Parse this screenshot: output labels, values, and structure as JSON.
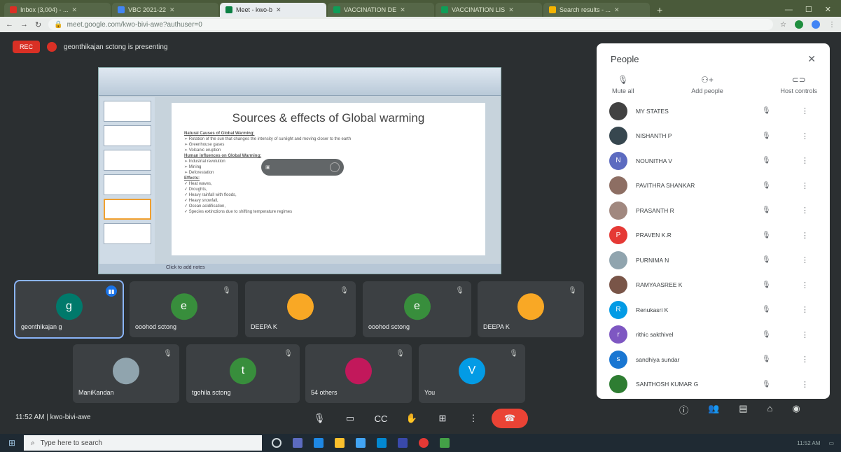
{
  "browser": {
    "tabs": [
      {
        "label": "Inbox (3,004) - ...",
        "color": "#d93025",
        "active": false
      },
      {
        "label": "VBC 2021-22",
        "color": "#4285f4",
        "active": false
      },
      {
        "label": "Meet - kwo-b",
        "color": "#0b8043",
        "active": true
      },
      {
        "label": "VACCINATION DE",
        "color": "#0f9d58",
        "active": false
      },
      {
        "label": "VACCINATION LIS",
        "color": "#0f9d58",
        "active": false
      },
      {
        "label": "Search results - ...",
        "color": "#f4b400",
        "active": false
      }
    ],
    "url": "meet.google.com/kwo-bivi-awe?authuser=0"
  },
  "meet": {
    "rec_label": "REC",
    "presenting_text": "geonthikajan sctong is presenting",
    "meeting_info": "11:52 AM  |  kwo-bivi-awe",
    "colors": {
      "accent": "#1a73e8",
      "hangup": "#ea4335",
      "panel_bg": "#ffffff",
      "stage_bg": "#2b2f31"
    }
  },
  "slide": {
    "title": "Sources & effects of Global warming",
    "lines": [
      {
        "text": "Natural Causes of Global Warming:",
        "heading": true
      },
      {
        "text": "➢  Rotation of the sun that changes the intensity of sunlight and moving closer to the earth",
        "heading": false
      },
      {
        "text": "➢  Greenhouse gases",
        "heading": false
      },
      {
        "text": "➢  Volcanic eruption",
        "heading": false
      },
      {
        "text": "Human influences on Global Warming:",
        "heading": true
      },
      {
        "text": "➢  Industrial revolution",
        "heading": false
      },
      {
        "text": "➢  Mining",
        "heading": false
      },
      {
        "text": "➢  Deforestation",
        "heading": false
      },
      {
        "text": "Effects:",
        "heading": true
      },
      {
        "text": "✓  Heat waves,",
        "heading": false
      },
      {
        "text": "✓  Droughts,",
        "heading": false
      },
      {
        "text": "✓  Heavy rainfall with floods,",
        "heading": false
      },
      {
        "text": "✓  Heavy snowfall,",
        "heading": false
      },
      {
        "text": "✓  Ocean acidification,",
        "heading": false
      },
      {
        "text": "✓  Species extinctions due to shifting temperature regimes",
        "heading": false
      }
    ],
    "status": "Click to add notes"
  },
  "tiles": [
    {
      "name": "geonthikajan g",
      "initial": "g",
      "color": "#00796b"
    },
    {
      "name": "ooohod sctong",
      "initial": "e",
      "color": "#388e3c"
    },
    {
      "name": "DEEPA K",
      "initial": "",
      "color": "#f9a825"
    },
    {
      "name": "ooohod sctong",
      "initial": "e",
      "color": "#388e3c"
    },
    {
      "name": "DEEPA K",
      "initial": "",
      "color": "#f9a825"
    },
    {
      "name": "ManiKandan",
      "initial": "",
      "color": "#90a4ae"
    },
    {
      "name": "tgohila sctong",
      "initial": "t",
      "color": "#388e3c"
    },
    {
      "name": "54 others",
      "initial": "",
      "color": "#c2185b"
    },
    {
      "name": "You",
      "initial": "V",
      "color": "#039be5"
    }
  ],
  "people": {
    "title": "People",
    "actions": {
      "mute_all": "Mute all",
      "add_people": "Add people",
      "host_controls": "Host controls"
    },
    "list": [
      {
        "name": "MY STATES",
        "color": "#424242",
        "initial": ""
      },
      {
        "name": "NISHANTH P",
        "color": "#37474f",
        "initial": ""
      },
      {
        "name": "NOUNITHA V",
        "color": "#5c6bc0",
        "initial": "N"
      },
      {
        "name": "PAVITHRA SHANKAR",
        "color": "#8d6e63",
        "initial": ""
      },
      {
        "name": "PRASANTH R",
        "color": "#a1887f",
        "initial": ""
      },
      {
        "name": "PRAVEN K.R",
        "color": "#e53935",
        "initial": "P"
      },
      {
        "name": "PURNIMA N",
        "color": "#90a4ae",
        "initial": ""
      },
      {
        "name": "RAMYAASREE K",
        "color": "#795548",
        "initial": ""
      },
      {
        "name": "Renukasri K",
        "color": "#039be5",
        "initial": "R"
      },
      {
        "name": "rithic sakthivel",
        "color": "#7e57c2",
        "initial": "r"
      },
      {
        "name": "sandhiya sundar",
        "color": "#1976d2",
        "initial": "s"
      },
      {
        "name": "SANTHOSH KUMAR G",
        "color": "#2e7d32",
        "initial": ""
      }
    ]
  },
  "taskbar": {
    "search_placeholder": "Type here to search",
    "clock": "11:52 AM"
  }
}
